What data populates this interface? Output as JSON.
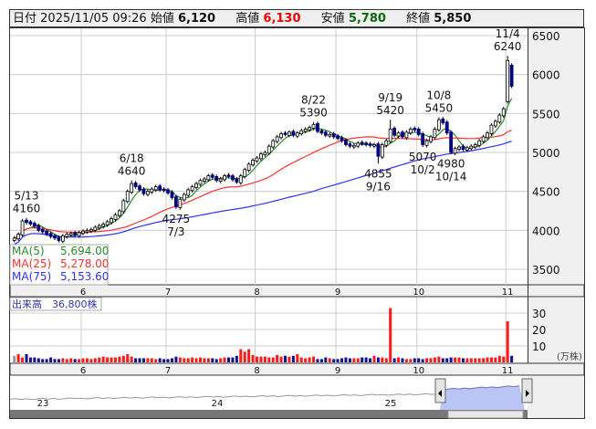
{
  "header": {
    "date_label": "日付",
    "datetime": "2025/11/05 09:26",
    "open_label": "始値",
    "open": "6,120",
    "high_label": "高値",
    "high": "6,130",
    "low_label": "安値",
    "low": "5,780",
    "close_label": "終値",
    "close": "5,850"
  },
  "legend": [
    {
      "label": "MA(5)",
      "value": "5,694.00",
      "color": "#2a8a2a"
    },
    {
      "label": "MA(25)",
      "value": "5,278.00",
      "color": "#ff3030"
    },
    {
      "label": "MA(75)",
      "value": "5,153.60",
      "color": "#3030ff"
    }
  ],
  "volume_label": "出来高　36,800株",
  "volume_unit": "(万株)",
  "navigator_labels": [
    "23",
    "24",
    "25"
  ],
  "chart_data": {
    "type": "candlestick",
    "y_ticks": [
      3500,
      4000,
      4500,
      5000,
      5500,
      6000,
      6500
    ],
    "ylim": [
      3300,
      6600
    ],
    "volume_ticks": [
      10,
      20,
      30
    ],
    "month_labels": [
      {
        "label": "6",
        "index": 17
      },
      {
        "label": "7",
        "index": 38
      },
      {
        "label": "8",
        "index": 60
      },
      {
        "label": "9",
        "index": 80
      },
      {
        "label": "10",
        "index": 100
      },
      {
        "label": "11",
        "index": 122
      }
    ],
    "close": [
      3900,
      3950,
      4120,
      4100,
      4080,
      4050,
      4000,
      3980,
      3950,
      3920,
      3900,
      3870,
      3930,
      3950,
      3960,
      3940,
      3970,
      3990,
      4000,
      4010,
      4040,
      4060,
      4080,
      4110,
      4150,
      4200,
      4250,
      4380,
      4500,
      4600,
      4560,
      4520,
      4470,
      4500,
      4530,
      4560,
      4520,
      4510,
      4480,
      4420,
      4300,
      4400,
      4460,
      4520,
      4560,
      4600,
      4640,
      4660,
      4700,
      4680,
      4640,
      4660,
      4700,
      4690,
      4650,
      4620,
      4700,
      4780,
      4850,
      4900,
      4930,
      4980,
      5000,
      5080,
      5150,
      5200,
      5240,
      5230,
      5260,
      5220,
      5250,
      5280,
      5300,
      5320,
      5360,
      5270,
      5250,
      5220,
      5230,
      5200,
      5180,
      5150,
      5100,
      5080,
      5090,
      5120,
      5110,
      5100,
      5090,
      5100,
      4950,
      5100,
      5150,
      5300,
      5220,
      5250,
      5200,
      5260,
      5300,
      5290,
      5230,
      5100,
      5150,
      5200,
      5300,
      5420,
      5380,
      5250,
      5000,
      5050,
      5070,
      5040,
      5060,
      5080,
      5100,
      5150,
      5200,
      5250,
      5350,
      5400,
      5480,
      5560,
      6180,
      5850
    ],
    "open_overrides": {
      "122": 5650,
      "123": 6120
    },
    "volume_man": [
      4,
      5,
      3,
      5,
      3,
      3,
      2.5,
      2,
      2,
      3,
      2,
      2,
      2.5,
      2,
      2.5,
      2,
      2,
      2.5,
      2.5,
      2,
      2.5,
      3,
      3.5,
      3,
      3,
      3,
      3.5,
      4,
      5,
      3.5,
      2.5,
      2.5,
      2.5,
      2.5,
      2.5,
      2,
      2.5,
      2,
      2,
      2.5,
      3.5,
      3,
      2.5,
      2.5,
      3,
      2.5,
      3,
      2.5,
      2.5,
      2.5,
      2,
      2.5,
      3,
      3,
      3,
      4,
      8,
      6.5,
      8,
      4.5,
      3.5,
      3.5,
      3.5,
      3,
      3,
      4.5,
      3.5,
      4,
      3.5,
      4,
      5,
      3,
      2.5,
      3,
      3.5,
      2,
      2,
      3,
      2.5,
      2,
      2,
      2.5,
      3,
      2.5,
      2.5,
      2.5,
      3,
      3,
      2.5,
      4,
      3,
      3,
      2.5,
      33,
      2.5,
      3,
      2.5,
      2,
      2,
      2.5,
      2.5,
      2,
      2.5,
      2.5,
      3,
      3.5,
      2.5,
      2.5,
      3,
      3,
      3,
      2.5,
      2.5,
      2.5,
      2.5,
      2.5,
      2.5,
      3,
      3,
      3,
      4,
      3.5,
      25,
      4
    ],
    "annotations": [
      {
        "index": 3,
        "date": "5/13",
        "value": "4160",
        "pos": "above"
      },
      {
        "index": 29,
        "date": "6/18",
        "value": "4640",
        "pos": "above"
      },
      {
        "index": 40,
        "date": "7/3",
        "value": "4275",
        "pos": "below"
      },
      {
        "index": 74,
        "date": "8/22",
        "value": "5390",
        "pos": "above"
      },
      {
        "index": 90,
        "date": "9/16",
        "value": "4855",
        "pos": "below"
      },
      {
        "index": 93,
        "date": "9/19",
        "value": "5420",
        "pos": "above"
      },
      {
        "index": 101,
        "date": "10/2",
        "value": "5070",
        "pos": "below"
      },
      {
        "index": 105,
        "date": "10/8",
        "value": "5450",
        "pos": "above"
      },
      {
        "index": 108,
        "date": "10/14",
        "value": "4980",
        "pos": "below"
      },
      {
        "index": 122,
        "date": "11/4",
        "value": "6240",
        "pos": "above"
      }
    ],
    "moving_averages": [
      5,
      25,
      75
    ]
  }
}
